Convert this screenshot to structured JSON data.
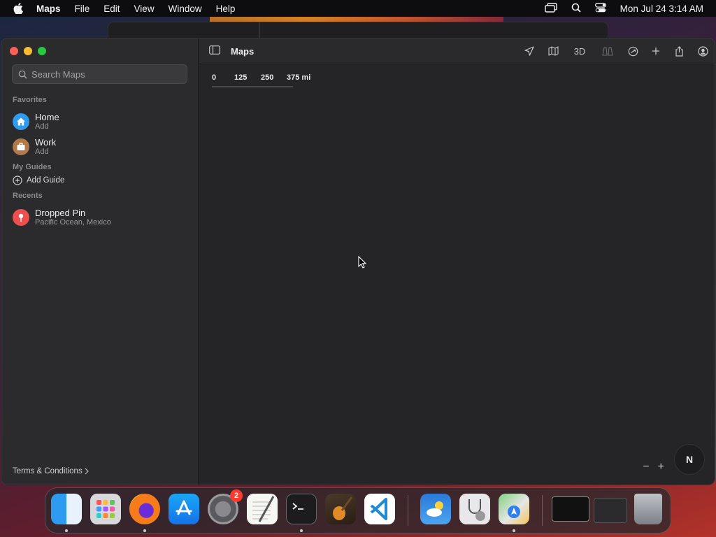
{
  "menubar": {
    "app_name": "Maps",
    "items": [
      "File",
      "Edit",
      "View",
      "Window",
      "Help"
    ],
    "clock": "Mon Jul 24  3:14 AM"
  },
  "window": {
    "title": "Maps",
    "search_placeholder": "Search Maps",
    "favorites_label": "Favorites",
    "favorites": [
      {
        "title": "Home",
        "sub": "Add",
        "color": "#2f9bef",
        "icon": "house-icon"
      },
      {
        "title": "Work",
        "sub": "Add",
        "color": "#b07a4a",
        "icon": "briefcase-icon"
      }
    ],
    "guides_label": "My Guides",
    "add_guide": "Add Guide",
    "recents_label": "Recents",
    "recents": [
      {
        "title": "Dropped Pin",
        "sub": "Pacific Ocean, Mexico",
        "color": "#ef4e4e",
        "icon": "pin-icon"
      }
    ],
    "terms": "Terms & Conditions",
    "toolbar": {
      "threed": "3D"
    },
    "scale_labels": [
      "0",
      "125",
      "250",
      "375 mi"
    ],
    "compass": "N",
    "zoom_out": "−",
    "zoom_in": "+"
  },
  "dock": {
    "settings_badge": "2",
    "apps": [
      "Finder",
      "Launchpad",
      "Firefox",
      "App Store",
      "System Settings",
      "TextEdit",
      "Terminal",
      "GarageBand",
      "Visual Studio Code",
      "Weather",
      "Disk Utility",
      "Maps",
      "Window 1",
      "Window 2",
      "Trash"
    ]
  },
  "colors": {
    "close": "#fe5f57",
    "minimize": "#febc2e",
    "maximize": "#28c840"
  }
}
